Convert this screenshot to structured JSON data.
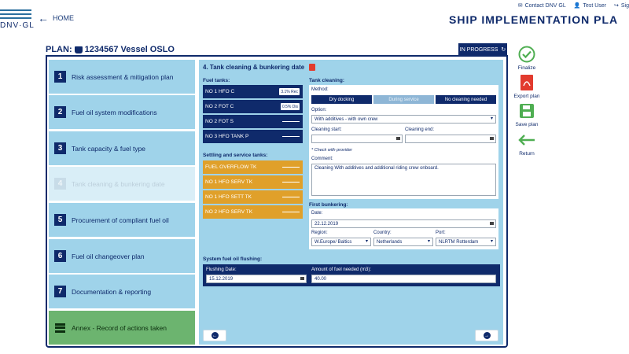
{
  "brand": {
    "logo_text": "DNV·GL"
  },
  "nav": {
    "home_label": "HOME"
  },
  "toplinks": {
    "contact": "Contact DNV GL",
    "user": "Test User",
    "signout": "Sig"
  },
  "app_title": "SHIP IMPLEMENTATION PLA",
  "plan": {
    "prefix": "PLAN:",
    "vessel": "1234567 Vessel OSLO",
    "status": "IN PROGRESS"
  },
  "steps": [
    {
      "num": "1",
      "label": "Risk assessment & mitigation plan"
    },
    {
      "num": "2",
      "label": "Fuel oil system modifications"
    },
    {
      "num": "3",
      "label": "Tank capacity & fuel type"
    },
    {
      "num": "4",
      "label": "Tank cleaning & bunkering date"
    },
    {
      "num": "5",
      "label": "Procurement of compliant fuel oil"
    },
    {
      "num": "6",
      "label": "Fuel oil changeover plan"
    },
    {
      "num": "7",
      "label": "Documentation & reporting"
    },
    {
      "label": "Annex - Record of actions taken"
    }
  ],
  "section": {
    "title": "4. Tank cleaning & bunkering date"
  },
  "fuel_tanks": {
    "label": "Fuel tanks:",
    "items": [
      {
        "name": "NO 1 HFO C",
        "tag": "3.1% Rec"
      },
      {
        "name": "NO 2 FOT C",
        "tag": "0.5% Dis"
      },
      {
        "name": "NO 2 FOT S",
        "tag": ""
      },
      {
        "name": "NO 3 HFO TANK P",
        "tag": ""
      }
    ]
  },
  "settling_tanks": {
    "label": "Settling and service tanks:",
    "items": [
      {
        "name": "FUEL OVERFLOW TK"
      },
      {
        "name": "NO 1 HFO SERV TK"
      },
      {
        "name": "NO 1 HFO SETT TK"
      },
      {
        "name": "NO 2 HFO SERV TK"
      }
    ]
  },
  "tank_cleaning": {
    "label": "Tank cleaning:",
    "method_label": "Method:",
    "methods": [
      "Dry docking",
      "During service",
      "No cleaning needed"
    ],
    "option_label": "Option:",
    "option_value": "With additives - with own crew",
    "cleaning_start_label": "Cleaning start:",
    "cleaning_start_value": "",
    "cleaning_end_label": "Cleaning end:",
    "cleaning_end_value": "",
    "note": "* Check with provider",
    "comment_label": "Comment:",
    "comment_value": "Cleaning With additives and additional riding crew onboard."
  },
  "first_bunkering": {
    "label": "First bunkering:",
    "date_label": "Date:",
    "date_value": "22.12.2019",
    "region_label": "Region:",
    "region_value": "W.Europe/ Baltics",
    "country_label": "Country:",
    "country_value": "Netherlands",
    "port_label": "Port:",
    "port_value": "NLRTM Rotterdam"
  },
  "flushing": {
    "label": "System fuel oil flushing:",
    "date_label": "Flushing Date:",
    "date_value": "15.12.2019",
    "amount_label": "Amount of fuel needed (m3):",
    "amount_value": "40.00"
  },
  "actions": {
    "finalize": "Finalize",
    "export": "Export plan",
    "save": "Save plan",
    "return": "Return"
  },
  "colors": {
    "navy": "#0f2a6b",
    "panel": "#9fd3ea",
    "orange": "#e0a02a",
    "green": "#6cb46f"
  }
}
